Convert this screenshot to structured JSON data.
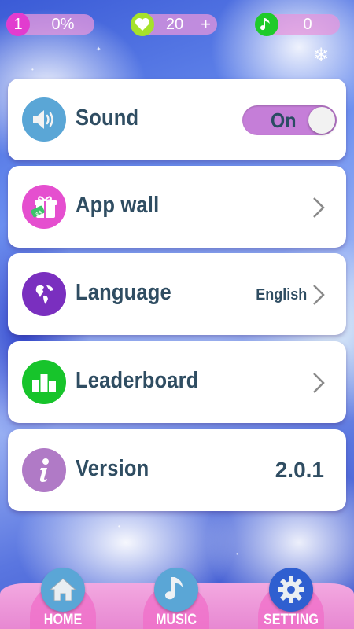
{
  "top_bar": {
    "level_badge": "1",
    "level_progress": "0%",
    "lives": "20",
    "lives_plus": "+",
    "notes": "0"
  },
  "settings": {
    "sound": {
      "label": "Sound",
      "toggle_value": "On",
      "icon": "speaker-icon"
    },
    "app_wall": {
      "label": "App wall",
      "icon": "gift-icon"
    },
    "language": {
      "label": "Language",
      "value": "English",
      "icon": "globe-icon"
    },
    "leaderboard": {
      "label": "Leaderboard",
      "icon": "podium-icon"
    },
    "version": {
      "label": "Version",
      "value": "2.0.1",
      "icon": "info-icon"
    }
  },
  "bottom_nav": {
    "home": {
      "label": "HOME",
      "icon": "house-icon"
    },
    "music": {
      "label": "MUSIC",
      "icon": "music-note-icon"
    },
    "setting": {
      "label": "SETTING",
      "icon": "gear-icon",
      "active": true
    }
  },
  "colors": {
    "accent_pink": "#e23ccf",
    "lives_green": "#a6e22a",
    "notes_green": "#1fcb2a",
    "toggle_purple": "#c57ed8",
    "sound_icon": "#5aa6d6",
    "app_wall_icon": "#e54fcf",
    "language_icon": "#7a2fbf",
    "leaderboard_icon": "#17c42b",
    "version_icon": "#b07ac6",
    "text_dark": "#2f4d62"
  }
}
